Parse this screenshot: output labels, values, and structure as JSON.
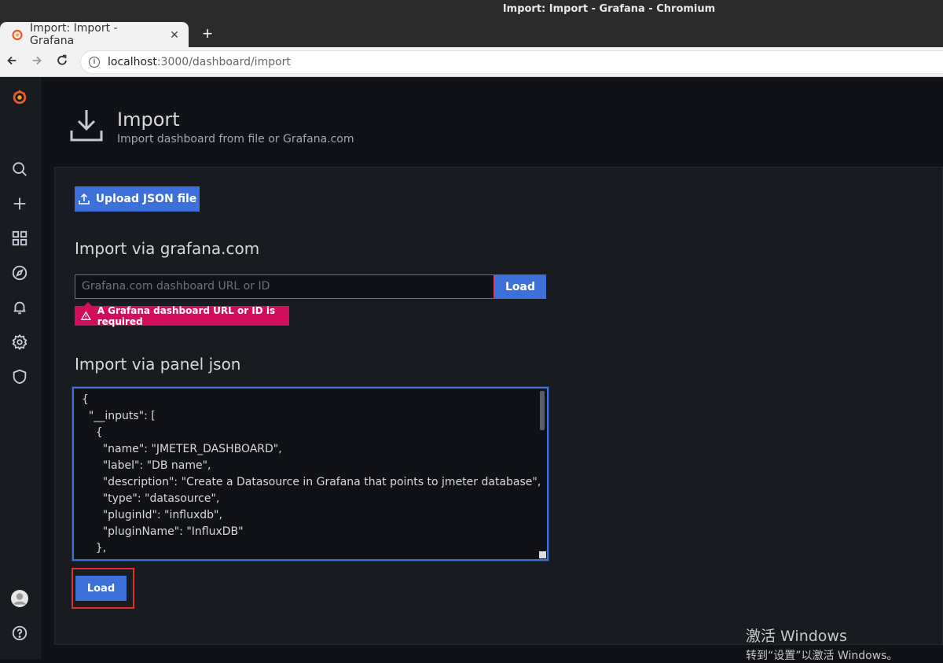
{
  "window": {
    "title": "Import: Import - Grafana - Chromium"
  },
  "browser": {
    "tab_title": "Import: Import - Grafana",
    "tab_close": "✕",
    "new_tab": "+",
    "url_host": "localhost",
    "url_rest": ":3000/dashboard/import"
  },
  "sidebar": {
    "items": [
      "grafana-logo-icon",
      "search-icon",
      "plus-icon",
      "dashboards-icon",
      "explore-icon",
      "alerting-icon",
      "configuration-icon",
      "shield-icon",
      "avatar-icon",
      "help-icon"
    ]
  },
  "header": {
    "title": "Import",
    "subtitle": "Import dashboard from file or Grafana.com"
  },
  "main": {
    "upload_label": "Upload JSON file",
    "gcom_title": "Import via grafana.com",
    "gcom_placeholder": "Grafana.com dashboard URL or ID",
    "gcom_load": "Load",
    "gcom_error": "A Grafana dashboard URL or ID is required",
    "panel_title": "Import via panel json",
    "panel_json": "{\n  \"__inputs\": [\n    {\n      \"name\": \"JMETER_DASHBOARD\",\n      \"label\": \"DB name\",\n      \"description\": \"Create a Datasource in Grafana that points to jmeter database\",\n      \"type\": \"datasource\",\n      \"pluginId\": \"influxdb\",\n      \"pluginName\": \"InfluxDB\"\n    },",
    "panel_load": "Load"
  },
  "watermark": {
    "line1": "激活 Windows",
    "line2": "转到“设置”以激活 Windows。"
  },
  "colors": {
    "primary": "#3d71d9",
    "error": "#d10e5c",
    "grafana_orange": "#f05a28"
  }
}
